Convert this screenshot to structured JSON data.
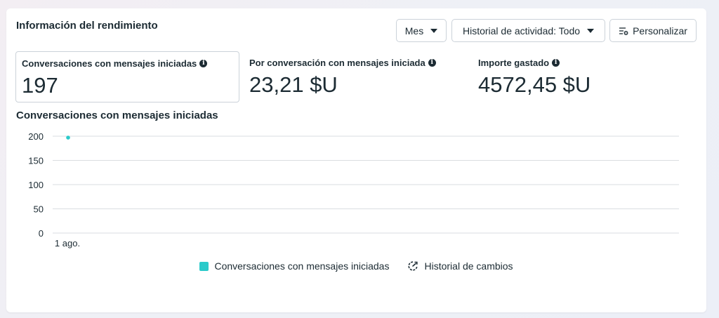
{
  "header": {
    "title": "Información del rendimiento",
    "month_button": "Mes",
    "history_button": "Historial de actividad: Todo",
    "customize_button": "Personalizar"
  },
  "metrics": [
    {
      "label": "Conversaciones con mensajes iniciadas",
      "value": "197"
    },
    {
      "label": "Por conversación con mensajes iniciada",
      "value": "23,21 $U"
    },
    {
      "label": "Importe gastado",
      "value": "4572,45 $U"
    }
  ],
  "icons": {
    "info": "info-icon",
    "caret": "chevron-down-icon",
    "customize": "sliders-gear-icon",
    "history": "change-history-icon"
  },
  "colors": {
    "series": "#2bcaca",
    "grid": "#dadde1",
    "text": "#1c2b33"
  },
  "chart_data": {
    "type": "line",
    "title": "Conversaciones con mensajes iniciadas",
    "x": [
      "1 ago."
    ],
    "y_ticks": [
      0,
      50,
      100,
      150,
      200
    ],
    "ylim": [
      0,
      200
    ],
    "series": [
      {
        "name": "Conversaciones con mensajes iniciadas",
        "values": [
          197
        ]
      }
    ],
    "grid": true,
    "legend_position": "bottom"
  },
  "legend": {
    "series_label": "Conversaciones con mensajes iniciadas",
    "history_label": "Historial de cambios"
  }
}
